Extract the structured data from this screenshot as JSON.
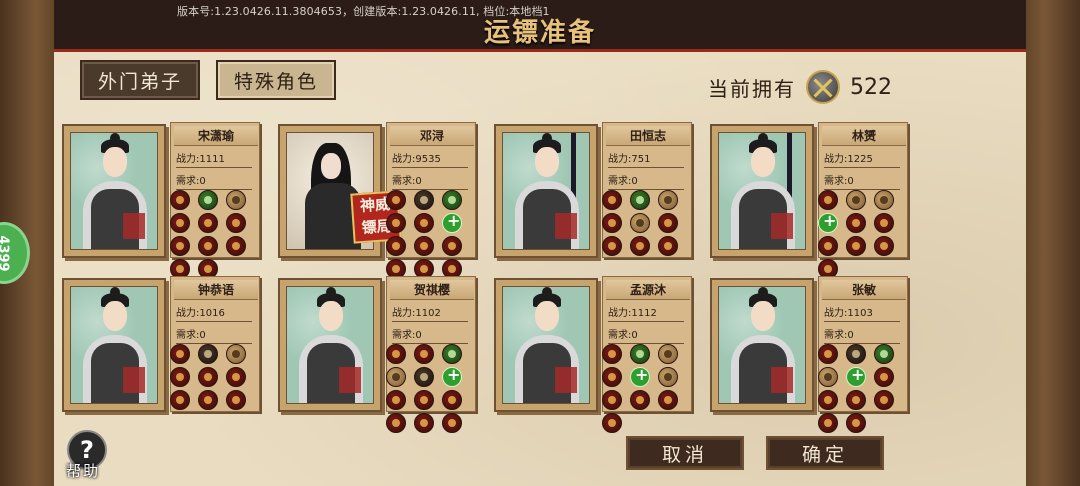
{
  "header": {
    "version_text": "版本号:1.23.0426.11.3804653，创建版本:1.23.0426.11, 档位:本地档1",
    "title": "运镖准备"
  },
  "tabs": [
    {
      "label": "外门弟子",
      "active": true
    },
    {
      "label": "特殊角色",
      "active": false
    }
  ],
  "owned": {
    "label": "当前拥有",
    "icon": "crossed-swords-icon",
    "count": "522"
  },
  "side_badge": "4399",
  "cards": [
    {
      "name": "宋潇瑜",
      "power": "战力:1111",
      "need": "需求:0",
      "type": "disciple",
      "icons": [
        "red",
        "green",
        "tan",
        "red",
        "red",
        "red",
        "red",
        "red",
        "red",
        "red",
        "red"
      ]
    },
    {
      "name": "邓浔",
      "power": "战力:9535",
      "need": "需求:0",
      "type": "special",
      "seal": "神威镖局",
      "icons": [
        "red",
        "dark",
        "green",
        "red",
        "red",
        "plus",
        "red",
        "red",
        "red",
        "red",
        "red",
        "red"
      ]
    },
    {
      "name": "田恒志",
      "power": "战力:751",
      "need": "需求:0",
      "type": "sword",
      "icons": [
        "red",
        "green",
        "tan",
        "red",
        "tan",
        "red",
        "red",
        "red",
        "red"
      ]
    },
    {
      "name": "林赟",
      "power": "战力:1225",
      "need": "需求:0",
      "type": "sword",
      "icons": [
        "red",
        "tan",
        "tan",
        "plus",
        "red",
        "red",
        "red",
        "red",
        "red",
        "red"
      ]
    },
    {
      "name": "钟恭语",
      "power": "战力:1016",
      "need": "需求:0",
      "type": "disciple",
      "icons": [
        "red",
        "dark",
        "tan",
        "red",
        "red",
        "red",
        "red",
        "red",
        "red"
      ]
    },
    {
      "name": "贺祺樱",
      "power": "战力:1102",
      "need": "需求:0",
      "type": "disciple",
      "icons": [
        "red",
        "red",
        "green",
        "tan",
        "dark",
        "plus",
        "red",
        "red",
        "red",
        "red",
        "red",
        "red"
      ]
    },
    {
      "name": "孟源沐",
      "power": "战力:1112",
      "need": "需求:0",
      "type": "disciple",
      "icons": [
        "red",
        "green",
        "tan",
        "red",
        "plus",
        "tan",
        "red",
        "red",
        "red",
        "red"
      ]
    },
    {
      "name": "张敏",
      "power": "战力:1103",
      "need": "需求:0",
      "type": "disciple",
      "icons": [
        "red",
        "dark",
        "green",
        "tan",
        "plus",
        "red",
        "red",
        "red",
        "red",
        "red",
        "red"
      ]
    }
  ],
  "buttons": {
    "cancel": "取消",
    "confirm": "确定",
    "help_label": "帮助",
    "help_symbol": "?"
  }
}
